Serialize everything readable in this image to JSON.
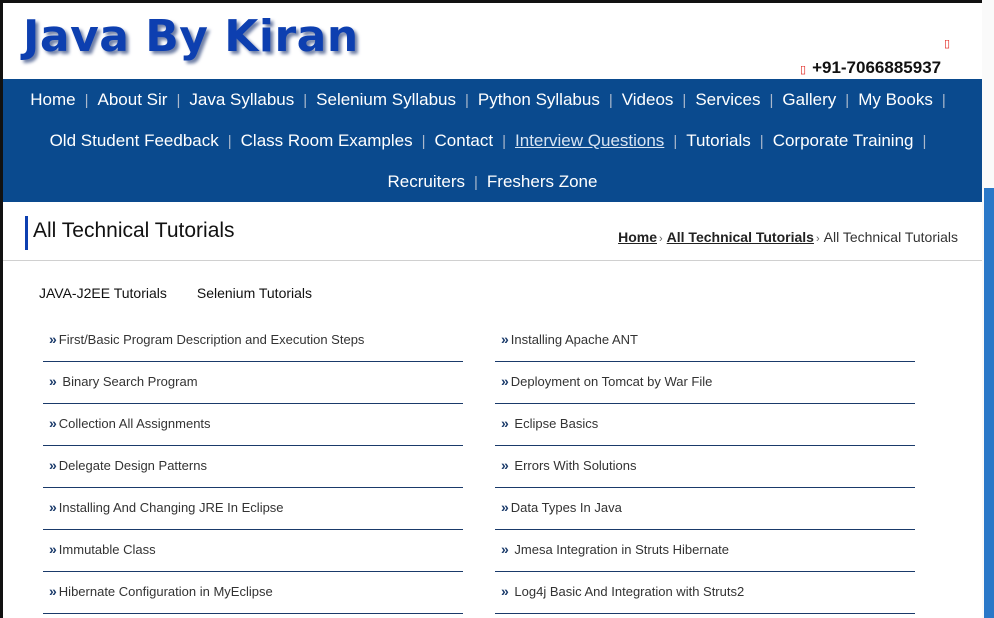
{
  "header": {
    "logo": "Java By Kiran",
    "icon_glyph": "▯",
    "phone_icon_glyph": "▯",
    "phone": "+91-7066885937",
    "icon_names": {
      "top": "mobile-icon",
      "phone": "phone-icon"
    },
    "colors": {
      "logo": "#0d3fb0",
      "nav_bg": "#0a4a8e",
      "icon": "#e0201a"
    }
  },
  "nav": {
    "separator": "|",
    "row1": [
      {
        "label": "Home"
      },
      {
        "label": "About Sir"
      },
      {
        "label": "Java Syllabus"
      },
      {
        "label": "Selenium Syllabus"
      },
      {
        "label": "Python Syllabus"
      },
      {
        "label": "Videos"
      },
      {
        "label": "Services"
      },
      {
        "label": "Gallery"
      },
      {
        "label": "My Books"
      }
    ],
    "row2": [
      {
        "label": "Old Student Feedback"
      },
      {
        "label": "Class Room Examples"
      },
      {
        "label": "Contact"
      },
      {
        "label": "Interview Questions"
      },
      {
        "label": "Tutorials"
      },
      {
        "label": "Corporate Training"
      }
    ],
    "row3": [
      {
        "label": "Recruiters"
      },
      {
        "label": "Freshers Zone"
      }
    ]
  },
  "page": {
    "title": "All Technical Tutorials",
    "breadcrumb": {
      "home": "Home",
      "section": "All Technical Tutorials",
      "current": "All Technical Tutorials",
      "chevron": "›"
    }
  },
  "tabs": {
    "java": "JAVA-J2EE Tutorials",
    "selenium": "Selenium Tutorials"
  },
  "bullet": "»",
  "left_items": [
    "First/Basic Program Description and Execution Steps",
    " Binary Search Program",
    "Collection All Assignments",
    "Delegate Design Patterns",
    "Installing And Changing JRE In Eclipse",
    "Immutable Class",
    "Hibernate Configuration in MyEclipse"
  ],
  "right_items": [
    "Installing Apache ANT",
    "Deployment on Tomcat by War File",
    " Eclipse Basics",
    " Errors With Solutions",
    "Data Types In Java",
    " Jmesa Integration in Struts Hibernate",
    " Log4j Basic And Integration with Struts2"
  ]
}
